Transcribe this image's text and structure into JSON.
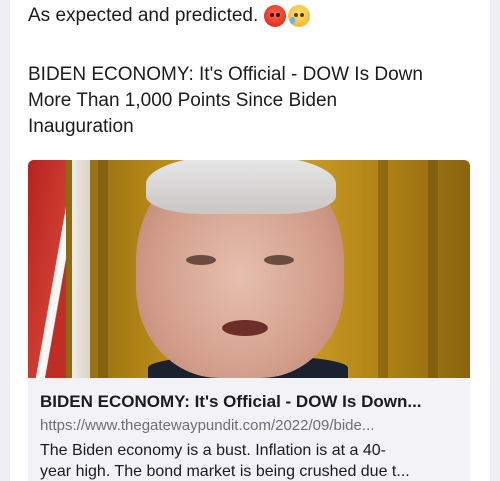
{
  "post": {
    "intro_text": "As expected and predicted.",
    "emoji_1": "angry-face-emoji",
    "emoji_2": "crying-face-emoji",
    "headline_line1": "BIDEN ECONOMY: It's Official - DOW Is Down",
    "headline_line2": "More Than 1,000 Points Since Biden",
    "headline_line3": "Inauguration"
  },
  "link_preview": {
    "image_icon": "portrait-photo",
    "title": "BIDEN ECONOMY: It's Official - DOW Is Down...",
    "url": "https://www.thegatewaypundit.com/2022/09/bide...",
    "description_line1": "The Biden economy is a bust. Inflation is at a 40-",
    "description_line2": "year high. The bond market is being crushed due t..."
  },
  "colors": {
    "background": "#ffffff",
    "card_background": "#f2f2f7",
    "url_gray": "#6e6e73"
  }
}
